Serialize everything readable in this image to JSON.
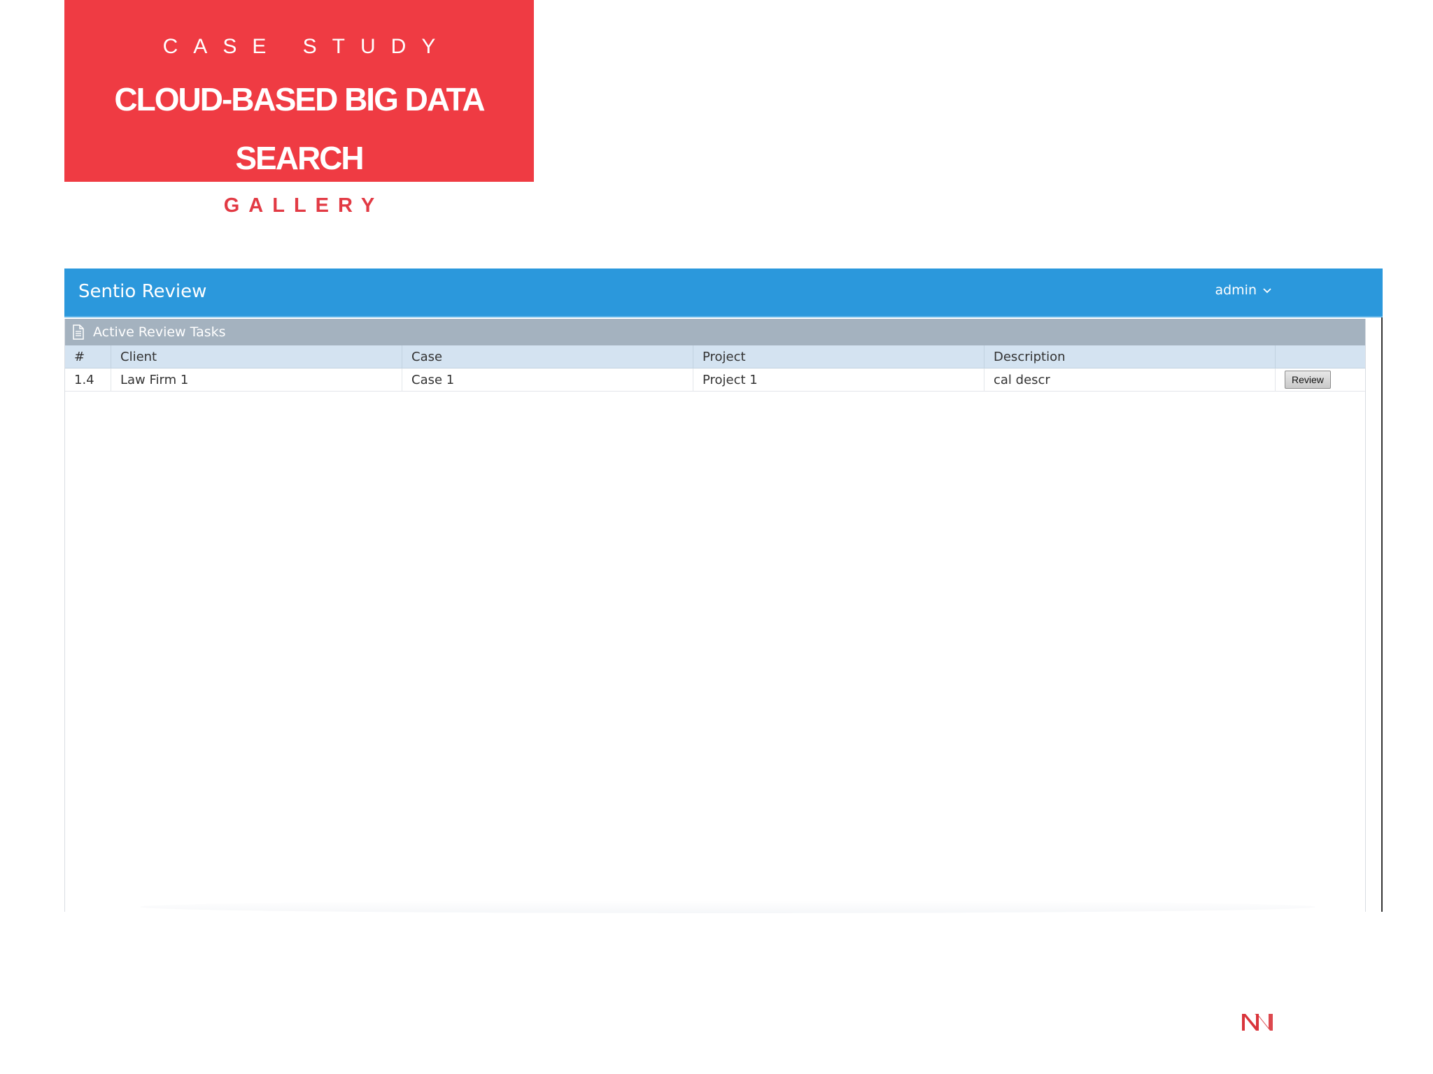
{
  "slide": {
    "case_study_label": "CASE STUDY",
    "title_line1": "CLOUD-BASED BIG DATA",
    "title_line2": "SEARCH",
    "gallery_label": "GALLERY",
    "accent_color": "#ef3b43"
  },
  "app": {
    "title": "Sentio Review",
    "user_menu_label": "admin",
    "header_color": "#2b98dc",
    "panel": {
      "heading": "Active Review Tasks",
      "heading_icon": "document-icon",
      "columns": [
        "#",
        "Client",
        "Case",
        "Project",
        "Description",
        ""
      ],
      "rows": [
        {
          "num": "1.4",
          "client": "Law Firm 1",
          "case": "Case 1",
          "project": "Project 1",
          "description": "cal descr",
          "action_label": "Review"
        }
      ]
    }
  },
  "footer": {
    "logo_icon": "company-logo-icon"
  }
}
